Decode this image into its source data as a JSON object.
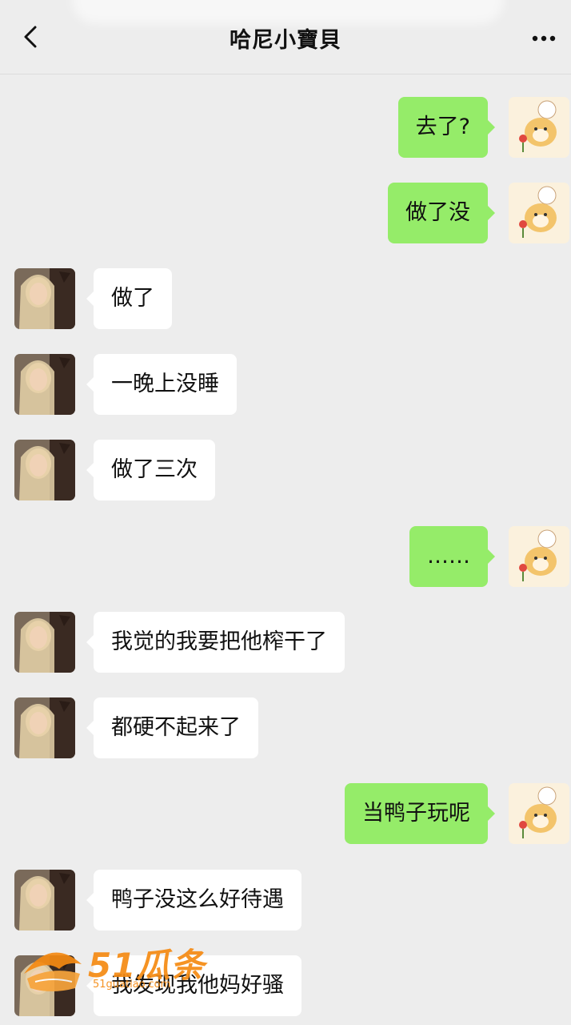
{
  "header": {
    "title": "哈尼小寶貝",
    "back_icon": "chevron-left-icon",
    "more_icon": "more-dots-icon"
  },
  "colors": {
    "background": "#ededed",
    "my_bubble": "#95ec69",
    "their_bubble": "#ffffff",
    "watermark": "#f58a12"
  },
  "messages": [
    {
      "from": "me",
      "text": "去了?"
    },
    {
      "from": "me",
      "text": "做了没"
    },
    {
      "from": "them",
      "text": "做了"
    },
    {
      "from": "them",
      "text": "一晚上没睡"
    },
    {
      "from": "them",
      "text": "做了三次"
    },
    {
      "from": "me",
      "text": "……"
    },
    {
      "from": "them",
      "text": "我觉的我要把他榨干了"
    },
    {
      "from": "them",
      "text": "都硬不起来了"
    },
    {
      "from": "me",
      "text": "当鸭子玩呢"
    },
    {
      "from": "them",
      "text": "鸭子没这么好待遇"
    },
    {
      "from": "them",
      "text": "我发现我他妈好骚"
    }
  ],
  "watermark": {
    "text": "51瓜条",
    "url": "51guatiao.com"
  }
}
